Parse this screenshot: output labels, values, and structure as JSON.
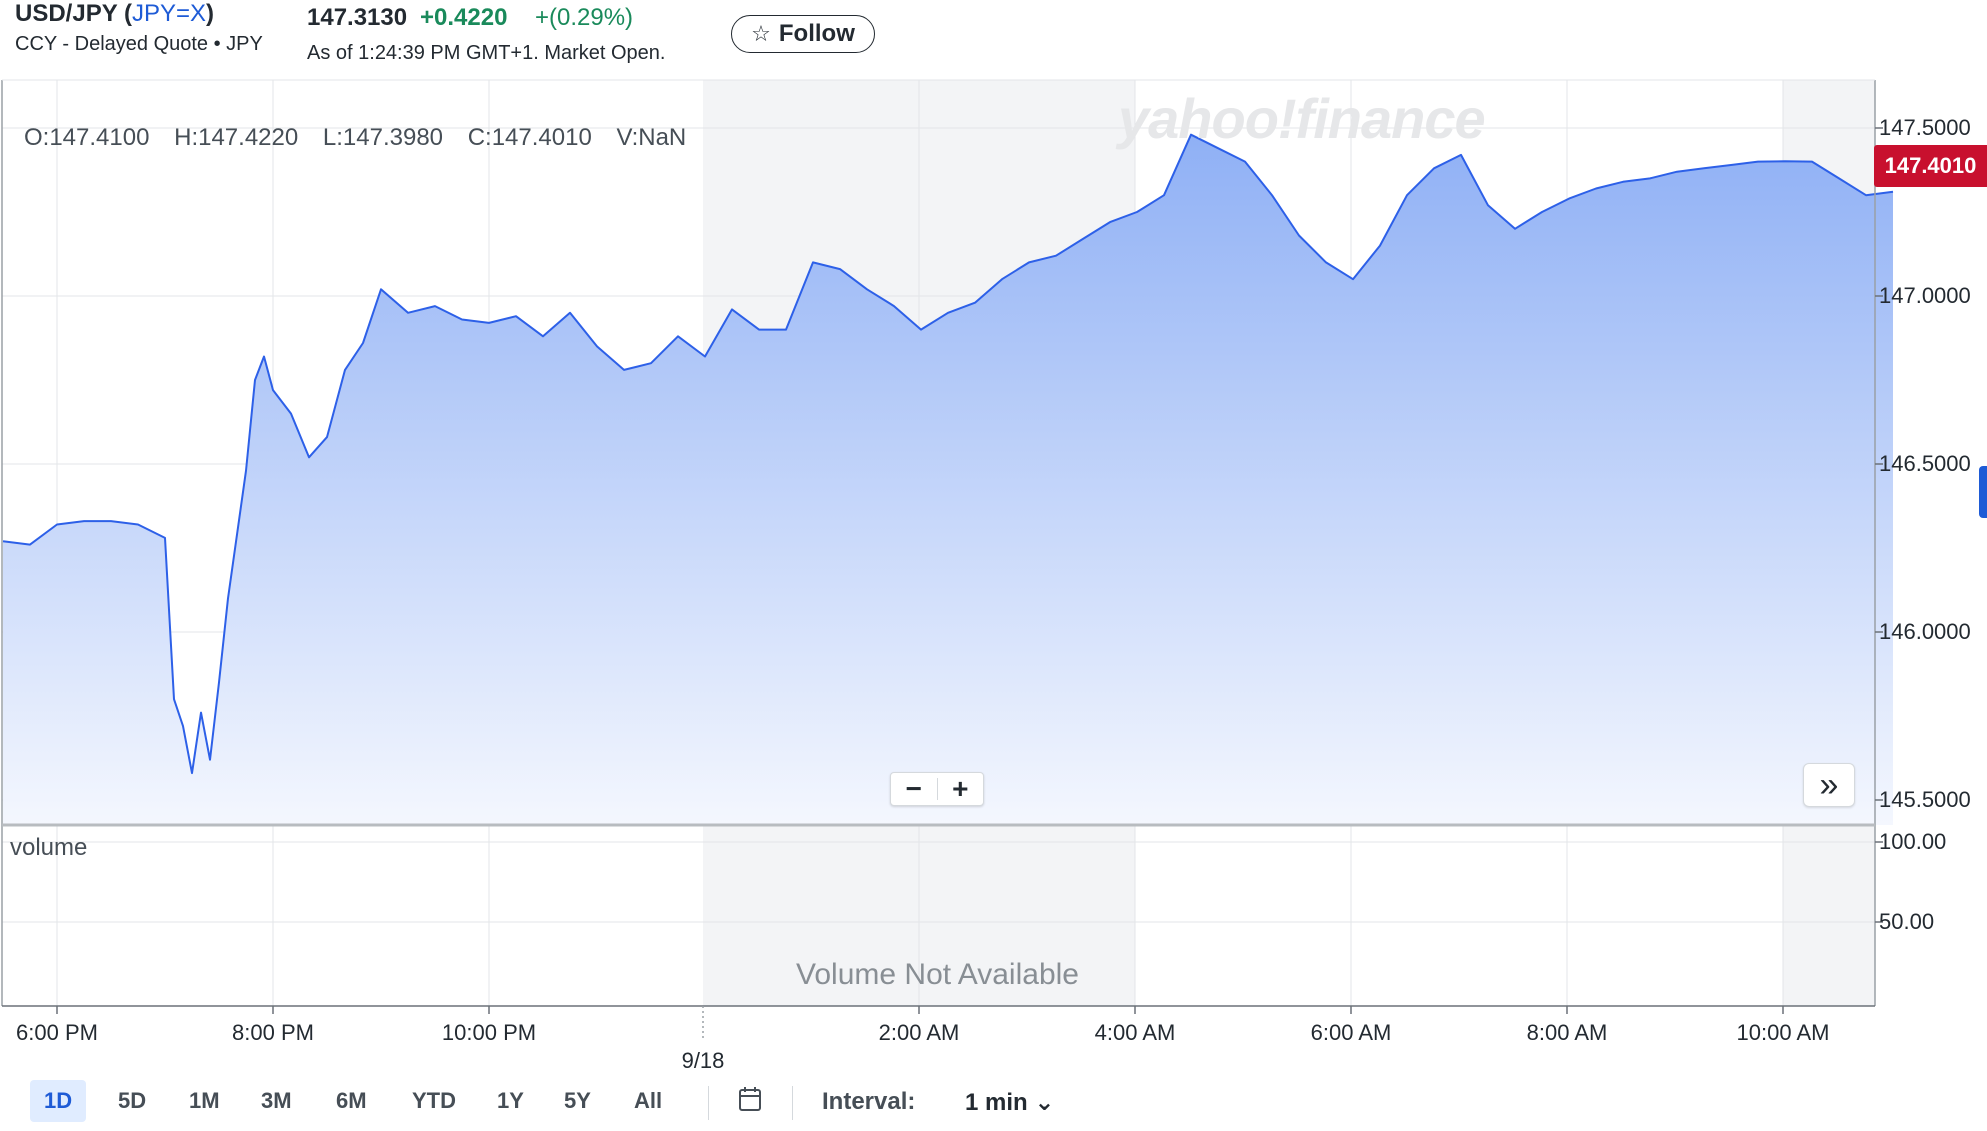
{
  "header": {
    "symbol_pair": "USD/JPY",
    "ticker_open": "(",
    "ticker": "JPY=X",
    "ticker_close": ")",
    "subtitle": "CCY - Delayed Quote • JPY",
    "price": "147.3130",
    "change": "+0.4220",
    "change_pct": "+(0.29%)",
    "as_of": "As of 1:24:39 PM GMT+1. Market Open.",
    "follow_label": "Follow"
  },
  "ohlc": {
    "open": "O:147.4100",
    "high": "H:147.4220",
    "low": "L:147.3980",
    "close": "C:147.4010",
    "volume": "V:NaN"
  },
  "watermark": "yahoo!finance",
  "last_price_badge": "147.4010",
  "volume_panel": {
    "label": "volume",
    "not_available": "Volume Not Available",
    "y_ticks": [
      "100.00",
      "50.00"
    ]
  },
  "chart_data": {
    "type": "area",
    "y_ticks": [
      "147.5000",
      "147.0000",
      "146.5000",
      "146.0000",
      "145.5000"
    ],
    "y_range": [
      145.5,
      147.5
    ],
    "x_ticks": [
      "6:00 PM",
      "8:00 PM",
      "10:00 PM",
      "2:00 AM",
      "4:00 AM",
      "6:00 AM",
      "8:00 AM",
      "10:00 AM"
    ],
    "date_marker": "9/18",
    "series": [
      {
        "x": [
          "17:30",
          "17:45",
          "18:00",
          "18:15",
          "18:30",
          "18:45",
          "19:00",
          "19:05",
          "19:10",
          "19:15",
          "19:20",
          "19:25",
          "19:30",
          "19:35",
          "19:45",
          "19:50",
          "19:55",
          "20:00",
          "20:10",
          "20:20",
          "20:30",
          "20:40",
          "20:50",
          "21:00",
          "21:15",
          "21:30",
          "21:45",
          "22:00",
          "22:15",
          "22:30",
          "22:45",
          "23:00",
          "23:15",
          "23:30",
          "23:45",
          "0:00",
          "0:15",
          "0:30",
          "0:45",
          "1:00",
          "1:15",
          "1:30",
          "1:45",
          "2:00",
          "2:15",
          "2:30",
          "2:45",
          "3:00",
          "3:15",
          "3:30",
          "3:45",
          "4:00",
          "4:15",
          "4:30",
          "4:45",
          "5:00",
          "5:15",
          "5:30",
          "5:45",
          "6:00",
          "6:15",
          "6:30",
          "6:45",
          "7:00",
          "7:15",
          "7:30",
          "7:45",
          "8:00",
          "8:15",
          "8:30",
          "8:45",
          "9:00",
          "9:15",
          "9:30",
          "9:45",
          "10:00",
          "10:15",
          "10:30",
          "10:45",
          "11:00"
        ],
        "y": [
          146.27,
          146.26,
          146.32,
          146.33,
          146.33,
          146.32,
          146.28,
          145.8,
          145.72,
          145.58,
          145.76,
          145.62,
          145.85,
          146.1,
          146.48,
          146.75,
          146.82,
          146.72,
          146.65,
          146.52,
          146.58,
          146.78,
          146.86,
          147.02,
          146.95,
          146.97,
          146.93,
          146.92,
          146.94,
          146.88,
          146.95,
          146.85,
          146.78,
          146.8,
          146.88,
          146.82,
          146.96,
          146.9,
          146.9,
          147.1,
          147.08,
          147.02,
          146.97,
          146.9,
          146.95,
          146.98,
          147.05,
          147.1,
          147.12,
          147.17,
          147.22,
          147.25,
          147.3,
          147.48,
          147.44,
          147.4,
          147.3,
          147.18,
          147.1,
          147.05,
          147.15,
          147.3,
          147.38,
          147.42,
          147.27,
          147.2,
          147.25,
          147.29,
          147.32,
          147.34,
          147.35,
          147.37,
          147.38,
          147.39,
          147.4,
          147.401,
          147.4,
          147.35,
          147.3,
          147.31
        ],
        "values": [
          146.27,
          146.26,
          146.32,
          146.33,
          146.33,
          146.32,
          146.28,
          145.8,
          145.72,
          145.58,
          145.76,
          145.62,
          145.85,
          146.1,
          146.48,
          146.75,
          146.82,
          146.72,
          146.65,
          146.52,
          146.58,
          146.78,
          146.86,
          147.02,
          146.95,
          146.97,
          146.93,
          146.92,
          146.94,
          146.88,
          146.95,
          146.85,
          146.78,
          146.8,
          146.88,
          146.82,
          146.96,
          146.9,
          146.9,
          147.1,
          147.08,
          147.02,
          146.97,
          146.9,
          146.95,
          146.98,
          147.05,
          147.1,
          147.12,
          147.17,
          147.22,
          147.25,
          147.3,
          147.48,
          147.44,
          147.4,
          147.3,
          147.18,
          147.1,
          147.05,
          147.15,
          147.3,
          147.38,
          147.42,
          147.27,
          147.2,
          147.25,
          147.29,
          147.32,
          147.34,
          147.35,
          147.37,
          147.38,
          147.39,
          147.4,
          147.401,
          147.4,
          147.35,
          147.3,
          147.31
        ]
      }
    ],
    "colors": {
      "line": "#2d60e8",
      "fill_top": "#8fb0f5",
      "fill_bottom": "#f4f7fe",
      "night_shade": "#f3f4f6",
      "badge": "#c8102e"
    }
  },
  "range_buttons": [
    "1D",
    "5D",
    "1M",
    "3M",
    "6M",
    "YTD",
    "1Y",
    "5Y",
    "All"
  ],
  "active_range": "1D",
  "calendar_icon": "calendar-icon",
  "interval": {
    "label": "Interval:",
    "value": "1 min ⌄"
  }
}
